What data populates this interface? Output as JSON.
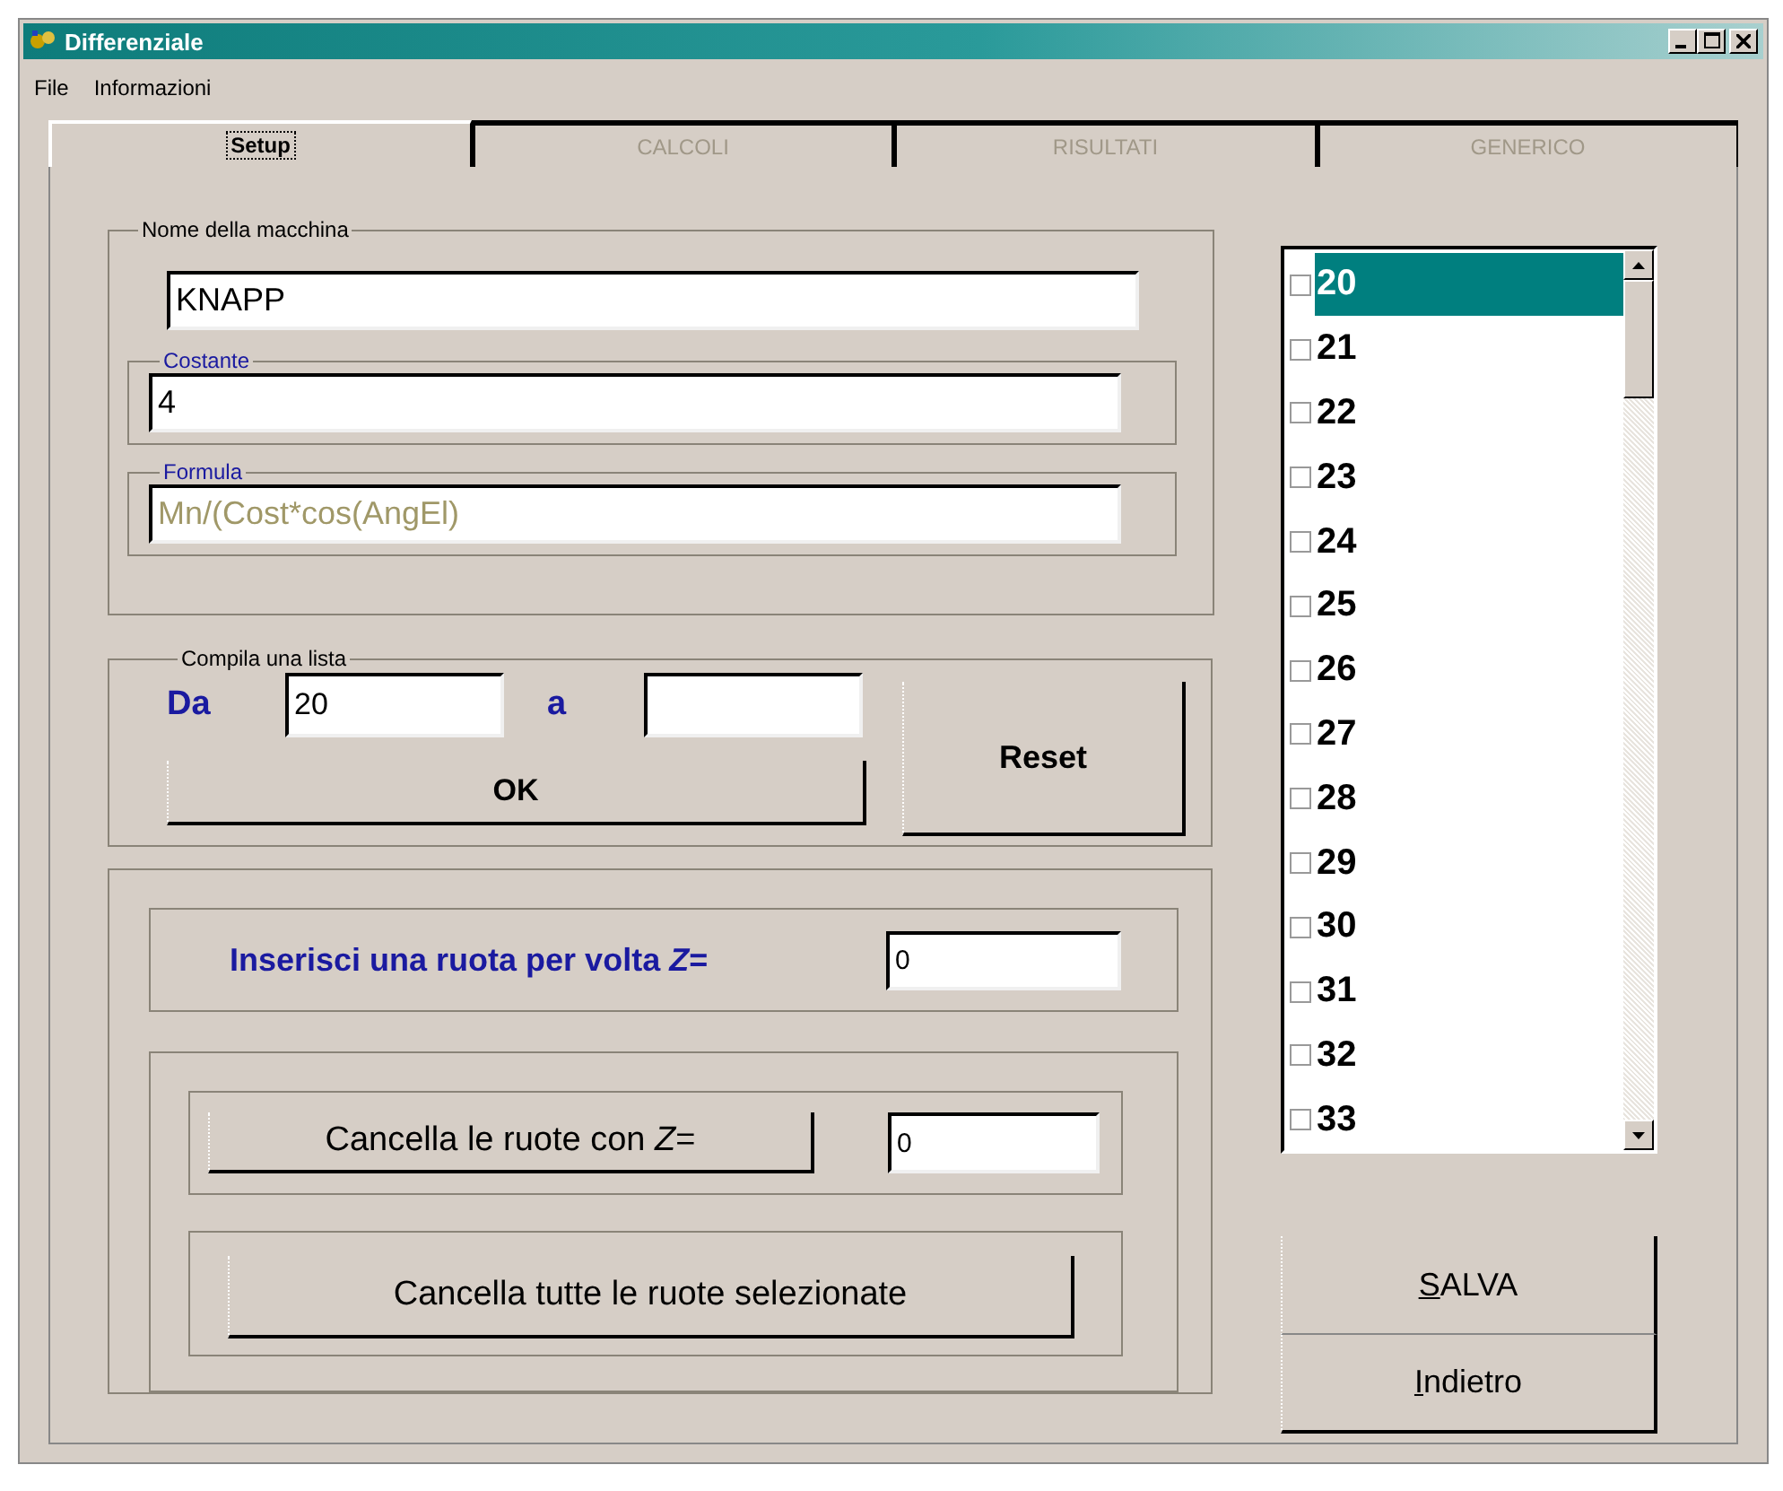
{
  "window": {
    "title": "Differenziale"
  },
  "menu": [
    "File",
    "Informazioni"
  ],
  "tabs": [
    {
      "label": "Setup",
      "selected": true,
      "disabled": false
    },
    {
      "label": "CALCOLI",
      "selected": false,
      "disabled": true
    },
    {
      "label": "RISULTATI",
      "selected": false,
      "disabled": true
    },
    {
      "label": "GENERICO",
      "selected": false,
      "disabled": true
    }
  ],
  "machine": {
    "legend": "Nome della macchina",
    "value": "KNAPP",
    "costante": {
      "legend": "Costante",
      "value": "4"
    },
    "formula": {
      "legend": "Formula",
      "value": "Mn/(Cost*cos(AngEl)",
      "disabled": true
    }
  },
  "compile_list": {
    "legend": "Compila una lista",
    "from_label": "Da",
    "from_value": "20",
    "to_label": "a",
    "ok_button": "OK",
    "reset_button": "Reset"
  },
  "insert": {
    "label": "Inserisci una ruota per volta *Z*=",
    "value": "0"
  },
  "delete_by_z": {
    "button": "Cancella le ruote con *Z*=",
    "value": "0"
  },
  "delete_all_button": "Cancella tutte le ruote selezionate",
  "wheel_list": [
    {
      "label": "20",
      "checked": false,
      "selected": true
    },
    {
      "label": "21",
      "checked": false,
      "selected": false
    },
    {
      "label": "22",
      "checked": false,
      "selected": false
    },
    {
      "label": "23",
      "checked": false,
      "selected": false
    },
    {
      "label": "24",
      "checked": false,
      "selected": false
    },
    {
      "label": "25",
      "checked": false,
      "selected": false
    },
    {
      "label": "26",
      "checked": false,
      "selected": false
    },
    {
      "label": "27",
      "checked": false,
      "selected": false
    },
    {
      "label": "28",
      "checked": false,
      "selected": false
    },
    {
      "label": "29",
      "checked": false,
      "selected": false
    },
    {
      "label": "30",
      "checked": false,
      "selected": false
    },
    {
      "label": "31",
      "checked": false,
      "selected": false
    },
    {
      "label": "32",
      "checked": false,
      "selected": false
    },
    {
      "label": "33",
      "checked": false,
      "selected": false
    }
  ],
  "buttons": [
    "SALVA",
    "Indietro"
  ]
}
